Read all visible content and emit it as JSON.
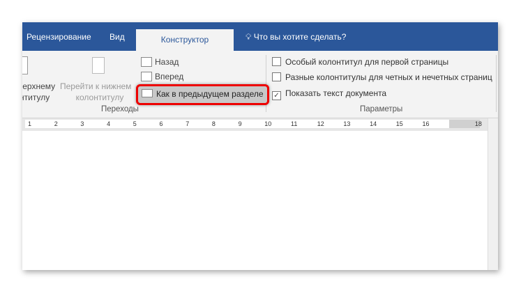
{
  "tabs": {
    "review": "Рецензирование",
    "view": "Вид",
    "design": "Конструктор",
    "tell_me": "Что вы хотите сделать?"
  },
  "navigation": {
    "goto_header_partial": [
      "верхнему",
      "нтитулу"
    ],
    "goto_footer": [
      "Перейти к нижнем",
      "колонтитулу"
    ],
    "previous": "Назад",
    "next": "Вперед",
    "link_previous": "Как в предыдущем разделе",
    "group_label": "Переходы"
  },
  "options": {
    "different_first": {
      "label": "Особый колонтитул для первой страницы",
      "checked": false
    },
    "different_odd_even": {
      "label": "Разные колонтитулы для четных и нечетных страниц",
      "checked": false
    },
    "show_doc_text": {
      "label": "Показать текст документа",
      "checked": true
    },
    "group_label": "Параметры"
  },
  "ruler": [
    "1",
    "2",
    "3",
    "4",
    "5",
    "6",
    "7",
    "8",
    "9",
    "10",
    "11",
    "12",
    "13",
    "14",
    "15",
    "16",
    "18"
  ],
  "colors": {
    "accent": "#2b579a",
    "highlight": "#e00000"
  }
}
